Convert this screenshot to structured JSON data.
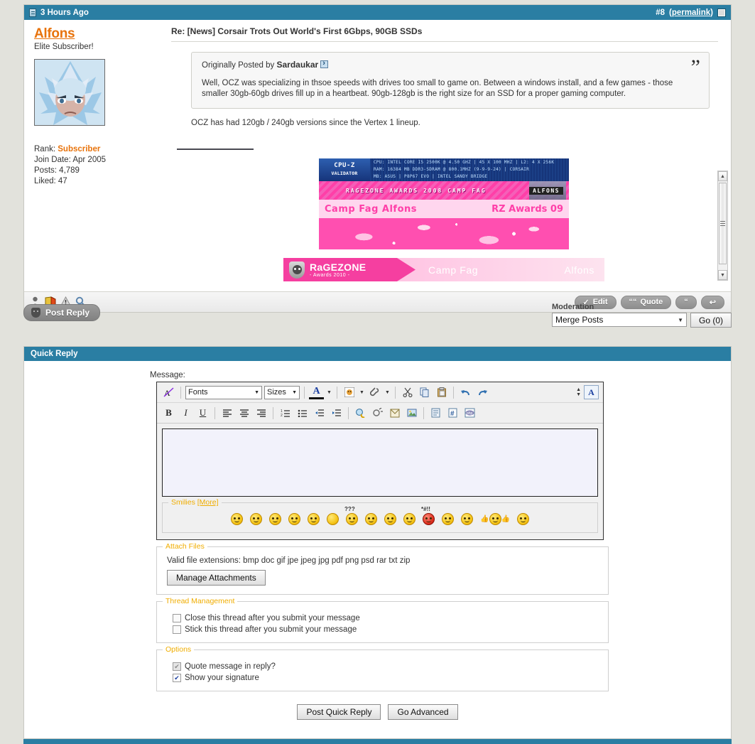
{
  "post": {
    "header": {
      "time": "3 Hours Ago",
      "post_number": "#8",
      "permalink": "(permalink)",
      "doc_icon": "document-icon",
      "select_box_icon": "select-post-checkbox"
    },
    "user": {
      "name": "Alfons",
      "title": "Elite Subscriber!",
      "rank_label": "Rank:",
      "rank_value": "Subscriber",
      "join_label": "Join Date:",
      "join_value": "Apr 2005",
      "posts_label": "Posts:",
      "posts_value": "4,789",
      "liked_label": "Liked:",
      "liked_value": "47",
      "avatar_alt": "anime-avatar"
    },
    "title": "Re: [News] Corsair Trots Out World's First 6Gbps, 90GB SSDs",
    "quote": {
      "attribution_prefix": "Originally Posted by",
      "author": "Sardaukar",
      "jump_icon": "go-to-post-icon",
      "quote_mark": "”",
      "body": "Well, OCZ was specializing in thsoe speeds with drives too small to game on. Between a windows install, and a few games - those smaller 30gb-60gb drives fill up in a heartbeat. 90gb-128gb is the right size for an SSD for a proper gaming computer."
    },
    "body": "OCZ has had 120gb / 240gb versions since the Vertex 1 lineup.",
    "signature": {
      "cpuz": {
        "brand": "CPU-Z",
        "sub": "VALIDATOR",
        "line1": "CPU: INTEL CORE I5 2500K @ 4.50 GHZ | 45 X 100 MHZ | L2: 4 X 256K",
        "line2": "RAM: 16384 MB DDR3-SDRAM @ 800.1MHZ (9-9-9-24) | CORSAIR",
        "line3": "MB: ASUS | P8P67 EVO | INTEL SANDY BRIDGE"
      },
      "awards_bar": "RAGEZONE AWARDS 2008   CAMP FAG",
      "awards_name": "ALFONS",
      "camp_left": "Camp Fag  Alfons",
      "camp_right": "RZ Awards 09",
      "rz2010": {
        "brand": "RaGEZONE",
        "sub": "- Awards 2010 -",
        "middle": "Camp Fag",
        "right": "Alfons",
        "shield_icon": "ragezone-shield-icon"
      }
    },
    "footer_icons": [
      {
        "name": "user-profile-icon"
      },
      {
        "name": "report-card-icon"
      },
      {
        "name": "warning-icon"
      },
      {
        "name": "search-posts-icon"
      }
    ],
    "buttons": {
      "edit": "Edit",
      "edit_icon": "✓",
      "quote": "Quote",
      "quote_icon": "““",
      "multiquote_icon": "“",
      "reply_icon": "↩"
    }
  },
  "reply_bar": {
    "post_reply": "Post Reply",
    "shield_icon": "shield-icon",
    "moderation_label": "Moderation",
    "moderation_value": "Merge Posts",
    "moderation_options": [
      "Merge Posts"
    ],
    "go_button": "Go (0)"
  },
  "quick_reply": {
    "title": "Quick Reply",
    "message_label": "Message:",
    "toolbar_row1": [
      {
        "name": "remove-formatting-icon",
        "glyph": "A̶"
      },
      {
        "name": "font-family-select",
        "label": "Fonts"
      },
      {
        "name": "font-size-select",
        "label": "Sizes"
      },
      {
        "name": "font-color-icon",
        "glyph": "A"
      },
      {
        "name": "smilie-insert-icon",
        "glyph": "☺"
      },
      {
        "name": "attachment-icon",
        "glyph": "📎"
      },
      {
        "name": "cut-icon",
        "glyph": "✂"
      },
      {
        "name": "copy-icon",
        "glyph": "⧉"
      },
      {
        "name": "paste-icon",
        "glyph": "📋"
      },
      {
        "name": "undo-icon",
        "glyph": "↶"
      },
      {
        "name": "redo-icon",
        "glyph": "↷"
      },
      {
        "name": "resize-editor-icon",
        "glyph": "↕"
      },
      {
        "name": "toggle-wysiwyg-icon",
        "glyph": "A"
      }
    ],
    "toolbar_row2": [
      {
        "name": "bold-icon",
        "glyph": "B"
      },
      {
        "name": "italic-icon",
        "glyph": "I"
      },
      {
        "name": "underline-icon",
        "glyph": "U"
      },
      {
        "name": "align-left-icon",
        "glyph": "≡"
      },
      {
        "name": "align-center-icon",
        "glyph": "≡"
      },
      {
        "name": "align-right-icon",
        "glyph": "≡"
      },
      {
        "name": "ordered-list-icon",
        "glyph": "≣"
      },
      {
        "name": "unordered-list-icon",
        "glyph": "≣"
      },
      {
        "name": "outdent-icon",
        "glyph": "⤇"
      },
      {
        "name": "indent-icon",
        "glyph": "⤆"
      },
      {
        "name": "insert-link-icon",
        "glyph": "🔗"
      },
      {
        "name": "remove-link-icon",
        "glyph": "⛓"
      },
      {
        "name": "insert-email-icon",
        "glyph": "✉"
      },
      {
        "name": "insert-image-icon",
        "glyph": "🖼"
      },
      {
        "name": "insert-quote-icon",
        "glyph": "❝"
      },
      {
        "name": "insert-code-icon",
        "glyph": "#"
      },
      {
        "name": "insert-php-icon",
        "glyph": "php"
      }
    ],
    "message_value": "",
    "smilies": {
      "legend": "Smilies",
      "more_link": "[More]",
      "items": [
        {
          "name": "smilie-eek",
          "type": "eek"
        },
        {
          "name": "smilie-sleepy",
          "type": "sleepy"
        },
        {
          "name": "smilie-blush",
          "type": "blush"
        },
        {
          "name": "smilie-tongue",
          "type": "tongue"
        },
        {
          "name": "smilie-yum",
          "type": "yum"
        },
        {
          "name": "smilie-blank",
          "type": "blank"
        },
        {
          "name": "smilie-confused",
          "type": "confused",
          "tag": "???"
        },
        {
          "name": "smilie-wink",
          "type": "wink"
        },
        {
          "name": "smilie-surprised",
          "type": "surprised"
        },
        {
          "name": "smilie-oh",
          "type": "oh"
        },
        {
          "name": "smilie-mad",
          "type": "mad",
          "tag": "*#!!"
        },
        {
          "name": "smilie-biggrin",
          "type": "biggrin"
        },
        {
          "name": "smilie-rolleyes",
          "type": "rolleyes"
        },
        {
          "name": "smilie-thumbsup",
          "type": "thumbsup"
        },
        {
          "name": "smilie-smirk",
          "type": "smirk"
        }
      ]
    },
    "attach_files": {
      "legend": "Attach Files",
      "extensions_text": "Valid file extensions: bmp doc gif jpe jpeg jpg pdf png psd rar txt zip",
      "manage_button": "Manage Attachments"
    },
    "thread_management": {
      "legend": "Thread Management",
      "options": [
        {
          "label": "Close this thread after you submit your message",
          "checked": false,
          "disabled": false
        },
        {
          "label": "Stick this thread after you submit your message",
          "checked": false,
          "disabled": false
        }
      ]
    },
    "options": {
      "legend": "Options",
      "items": [
        {
          "label": "Quote message in reply?",
          "checked": true,
          "disabled": true
        },
        {
          "label": "Show your signature",
          "checked": true,
          "disabled": false
        }
      ]
    },
    "submit": {
      "post_quick_reply": "Post Quick Reply",
      "go_advanced": "Go Advanced"
    }
  },
  "colors": {
    "header_blue": "#2a7ea3",
    "username_orange": "#e8730c",
    "legend_yellow": "#f0ad00",
    "page_bg": "#e2e2dc"
  }
}
